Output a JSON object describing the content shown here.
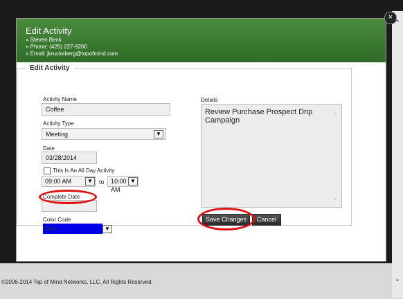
{
  "modal": {
    "title": "Edit Activity",
    "contact_name": "» Steven Beck",
    "phone": "» Phone: (425) 227-9200",
    "email": "» Email: jkruckeberg@topofmind.com",
    "close_glyph": "×"
  },
  "form": {
    "legend": "Edit Activity",
    "activity_name_label": "Activity Name",
    "activity_name_value": "Coffee",
    "activity_type_label": "Activity Type",
    "activity_type_value": "Meeting",
    "date_label": "Date",
    "date_value": "03/28/2014",
    "all_day_label": "This Is An All Day Activity",
    "all_day_checked": false,
    "start_time": "09:00 AM",
    "to_label": "to",
    "end_time": "10:00 AM",
    "complete_date_label": "Complete Date",
    "complete_date_value": "",
    "color_code_label": "Color Code",
    "color_code_value": "Blue",
    "color_code_swatch": "#0000e6",
    "details_label": "Details",
    "details_value": "Review Purchase Prospect Drip Campaign"
  },
  "buttons": {
    "save": "Save Changes",
    "cancel": "Cancel"
  },
  "footer": {
    "copyright": "©2006-2014 Top of Mind Networks, LLC. All Rights Reserved."
  },
  "colors": {
    "header_green": "#3a7a30",
    "highlight_red": "#e01010"
  },
  "icons": {
    "dropdown": "chevron-down-icon",
    "close": "close-icon",
    "scroll_up": "chevron-up-icon",
    "scroll_down": "chevron-down-icon"
  }
}
